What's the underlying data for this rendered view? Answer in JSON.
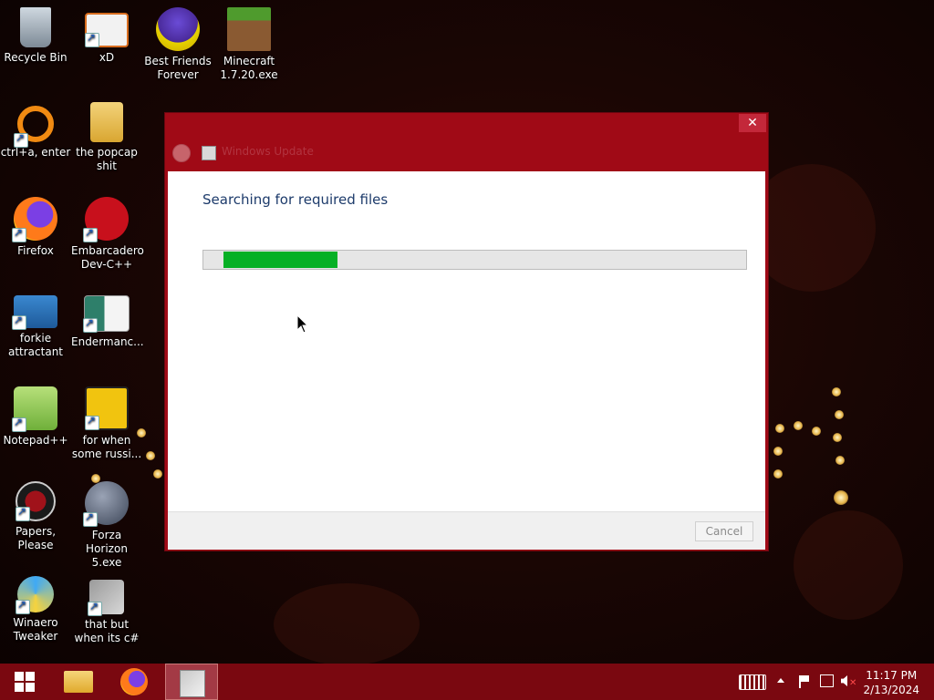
{
  "desktop": {
    "icons": [
      {
        "label": "Recycle Bin"
      },
      {
        "label": "xD"
      },
      {
        "label": "Best Friends Forever"
      },
      {
        "label": "Minecraft 1.7.20.exe"
      },
      {
        "label": "ctrl+a, enter"
      },
      {
        "label": "the popcap shit"
      },
      {
        "label": "Firefox"
      },
      {
        "label": "Embarcadero Dev-C++"
      },
      {
        "label": "forkie attractant"
      },
      {
        "label": "Endermanc..."
      },
      {
        "label": "Notepad++"
      },
      {
        "label": "for when some russi..."
      },
      {
        "label": "Papers, Please"
      },
      {
        "label": "Forza Horizon 5.exe"
      },
      {
        "label": "Winaero Tweaker"
      },
      {
        "label": "that but when its c#"
      }
    ]
  },
  "dialog": {
    "title": "Windows Update",
    "close_label": "✕",
    "heading": "Searching for required files",
    "progress_fraction": 0.21,
    "cancel_label": "Cancel"
  },
  "taskbar": {
    "items": [
      {
        "icon": "windows-start-icon"
      },
      {
        "icon": "file-explorer-icon"
      },
      {
        "icon": "firefox-icon"
      },
      {
        "icon": "setup-app-icon"
      }
    ],
    "tray": {
      "icons": [
        "keyboard-icon",
        "chevron-up-icon",
        "flag-icon",
        "network-icon",
        "volume-muted-icon"
      ]
    },
    "clock_time": "11:17 PM",
    "clock_date": "2/13/2024"
  },
  "colors": {
    "titlebar": "#a00a16",
    "taskbar": "#7a0810",
    "progress_fill": "#06b025"
  }
}
